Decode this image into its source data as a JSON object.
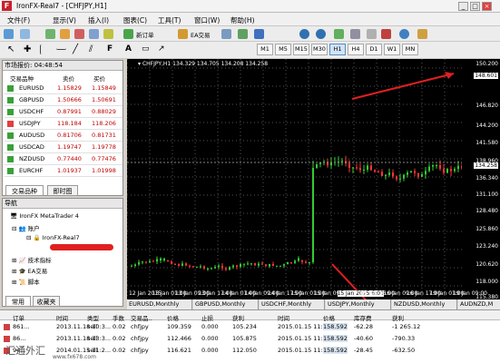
{
  "window": {
    "title": "IronFX-Real7 - [CHFJPY,H1]"
  },
  "menu": [
    "文件(F)",
    "显示(V)",
    "插入(I)",
    "图表(C)",
    "工具(T)",
    "窗口(W)",
    "帮助(H)"
  ],
  "toolbar": {
    "new_order": "新订单",
    "ea_trading": "EA交易",
    "timeframes": [
      "M1",
      "M5",
      "M15",
      "M30",
      "H1",
      "H4",
      "D1",
      "W1",
      "MN"
    ],
    "active_timeframe": "H1"
  },
  "market_watch": {
    "title": "市场报价: 04:48:54",
    "columns": [
      "交易品种",
      "卖价",
      "买价"
    ],
    "rows": [
      {
        "symbol": "EURUSD",
        "bid": "1.15829",
        "ask": "1.15849"
      },
      {
        "symbol": "GBPUSD",
        "bid": "1.50666",
        "ask": "1.50691"
      },
      {
        "symbol": "USDCHF",
        "bid": "0.87991",
        "ask": "0.88029"
      },
      {
        "symbol": "USDJPY",
        "bid": "118.184",
        "ask": "118.206"
      },
      {
        "symbol": "AUDUSD",
        "bid": "0.81706",
        "ask": "0.81731"
      },
      {
        "symbol": "USDCAD",
        "bid": "1.19747",
        "ask": "1.19778"
      },
      {
        "symbol": "NZDUSD",
        "bid": "0.77440",
        "ask": "0.77476"
      },
      {
        "symbol": "EURCHF",
        "bid": "1.01937",
        "ask": "1.01998"
      }
    ],
    "tabs": [
      "交易品种",
      "即时图"
    ]
  },
  "navigator": {
    "title": "导航",
    "root": "IronFX MetaTrader 4",
    "accounts": "账户",
    "account_name": "IronFX-Real7",
    "indicators": "技术指标",
    "experts": "EA交易",
    "scripts": "脚本",
    "tabs": [
      "常用",
      "收藏夹"
    ]
  },
  "chart": {
    "header": "CHFJPY,H1  134.329 134.705 134.208 134.258",
    "current_price": "134.258",
    "high_marker": "148.601",
    "price_labels": [
      "150.200",
      "148.601",
      "146.820",
      "144.200",
      "141.580",
      "138.960",
      "136.340",
      "134.258",
      "131.100",
      "128.480",
      "125.860",
      "123.240",
      "120.620",
      "118.000",
      "115.380"
    ],
    "time_labels": [
      "12 Jan 2015",
      "13 Jan 01:00",
      "13 Jan 09:00",
      "13 Jan 17:00",
      "14 Jan 01:00",
      "14 Jan 09:00",
      "14 Jan 17:00",
      "15 Jan 01:00",
      "15 Jan 09:00",
      "15 Jan 2015 6:00",
      "15 Jan 16:00",
      "16 Jan 09:00",
      "16 Jan 17:00",
      "19 Jan 01:00",
      "19 Jan 09:00"
    ],
    "tabs": [
      "EURUSD,Monthly",
      "GBPUSD,Monthly",
      "USDCHF,Monthly",
      "USDJPY,Monthly",
      "NZDUSD,Monthly",
      "AUDNZD,M"
    ]
  },
  "terminal": {
    "columns": [
      "订单",
      "时间",
      "类型",
      "手数",
      "交易品..",
      "价格",
      "止损",
      "获利",
      "时间",
      "价格",
      "库存费",
      "获利"
    ],
    "rows": [
      {
        "order": "861...",
        "time": "2013.11.18 10:3...",
        "type": "sell",
        "lots": "0.02",
        "symbol": "chfjpy",
        "price": "109.359",
        "sl": "0.000",
        "tp": "105.234",
        "ctime": "2015.01.15 11:5...",
        "cprice": "158.592",
        "swap": "-62.28",
        "profit": "-1 265.12"
      },
      {
        "order": "86...",
        "time": "2013.11.18 13:3...",
        "type": "sell",
        "lots": "0.02",
        "symbol": "chfjpy",
        "price": "112.466",
        "sl": "0.000",
        "tp": "105.875",
        "ctime": "2015.01.15 11:5...",
        "cprice": "158.592",
        "swap": "-40.60",
        "profit": "-790.33"
      },
      {
        "order": "94...",
        "time": "2014.01.15 11:2...",
        "type": "sell",
        "lots": "0.02",
        "symbol": "chfjpy",
        "price": "116.621",
        "sl": "0.000",
        "tp": "112.050",
        "ctime": "2015.01.15 11:5...",
        "cprice": "158.592",
        "swap": "-28.45",
        "profit": "-632.50"
      }
    ],
    "watermark": "汇通外汇",
    "watermark_url": "www.fx678.com"
  }
}
